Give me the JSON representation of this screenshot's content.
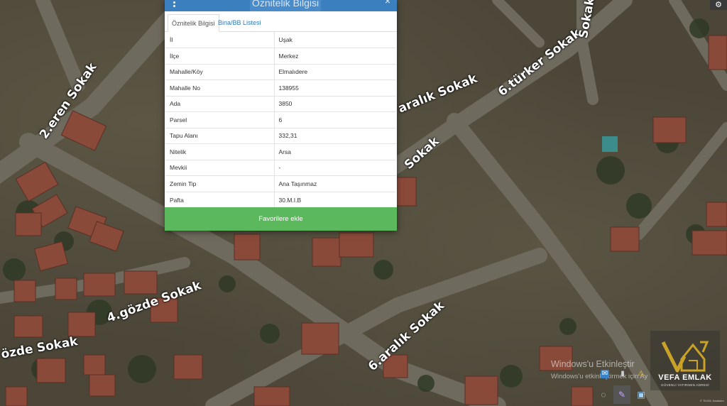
{
  "map": {
    "streets": [
      "2.eren Sokak",
      "6.türker Sokak",
      "aralık Sokak",
      "Sokak",
      "4.gözde Sokak",
      "6.aralık Sokak",
      "özde Sokak",
      "Sokak"
    ],
    "attribution": "© TKGM, Kadastro"
  },
  "popup": {
    "title": "Öznitelik Bilgisi",
    "tabs": [
      {
        "label": "Öznitelik Bilgisi",
        "active": true
      },
      {
        "label": "Bina/BB Listesi",
        "active": false
      }
    ],
    "rows": [
      {
        "key": "İl",
        "value": "Uşak"
      },
      {
        "key": "İlçe",
        "value": "Merkez"
      },
      {
        "key": "Mahalle/Köy",
        "value": "Elmalıdere"
      },
      {
        "key": "Mahalle No",
        "value": "138955"
      },
      {
        "key": "Ada",
        "value": "3850"
      },
      {
        "key": "Parsel",
        "value": "6"
      },
      {
        "key": "Tapu Alanı",
        "value": "332,31"
      },
      {
        "key": "Nitelik",
        "value": "Arsa"
      },
      {
        "key": "Mevkii",
        "value": "-"
      },
      {
        "key": "Zemin Tip",
        "value": "Ana Taşınmaz"
      },
      {
        "key": "Pafta",
        "value": "30.M.I.B"
      }
    ],
    "favorite_button": "Favorilere ekle",
    "close_glyph": "×"
  },
  "watermark": {
    "line1": "Windows'u Etkinleştir",
    "line2": "Windows'u etkinleştirmek için Ay"
  },
  "logo": {
    "name": "VEFA EMLAK",
    "tagline": "GÜVENLİ YATIRIMIN ADRESİ"
  },
  "colors": {
    "header_blue": "#3c7fbe",
    "button_green": "#5cb85c",
    "link_blue": "#337ab7",
    "logo_gold": "#c9a227"
  }
}
